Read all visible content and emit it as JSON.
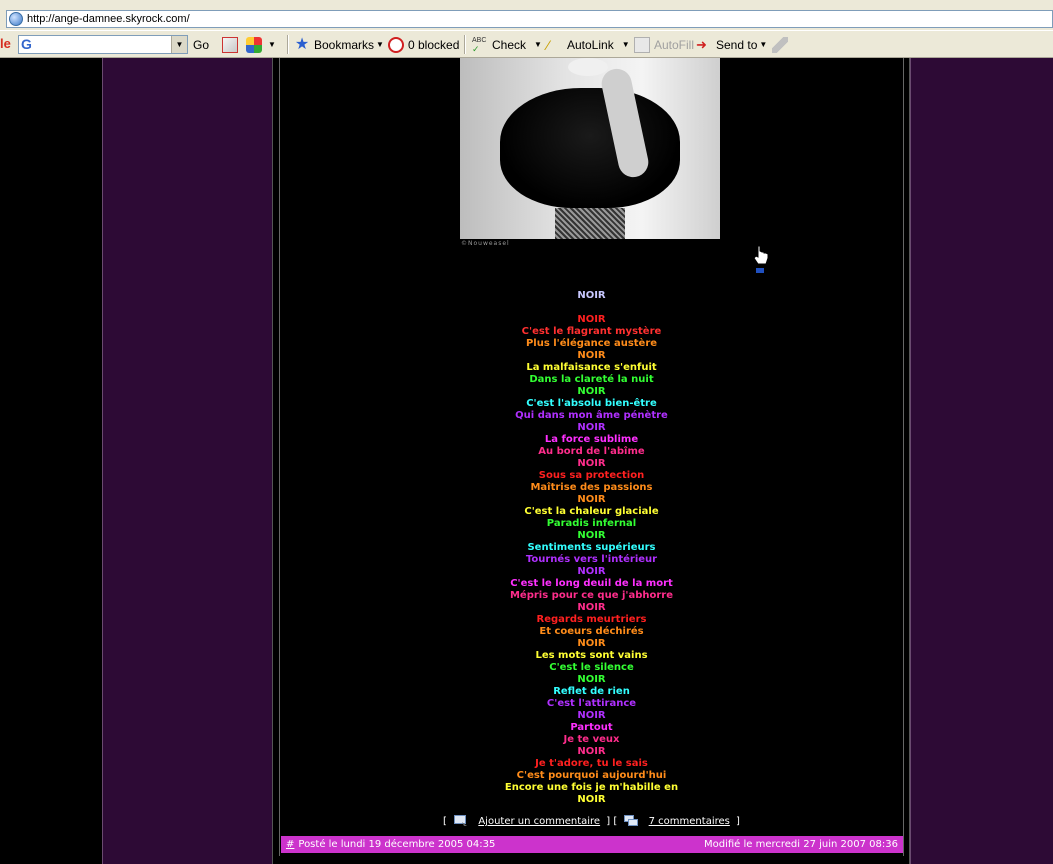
{
  "browser": {
    "address": "http://ange-damnee.skyrock.com/",
    "toolbar": {
      "go_label": "Go",
      "bookmarks_label": "Bookmarks",
      "blocked_label": "0 blocked",
      "check_label": "Check",
      "autolink_label": "AutoLink",
      "autofill_label": "AutoFill",
      "sendto_label": "Send to"
    }
  },
  "post": {
    "photo_caption": "©Nouweasel",
    "poem_title": "NOIR",
    "poem": [
      {
        "text": "NOIR",
        "color": "#ff2020"
      },
      {
        "text": "C'est le flagrant mystère",
        "color": "#ff3030"
      },
      {
        "text": "Plus l'élégance austère",
        "color": "#ff8c1a"
      },
      {
        "text": "NOIR",
        "color": "#ff8c1a"
      },
      {
        "text": "La malfaisance s'enfuit",
        "color": "#ffff33"
      },
      {
        "text": "Dans la clareté la nuit",
        "color": "#33ff33"
      },
      {
        "text": "NOIR",
        "color": "#33ff33"
      },
      {
        "text": "C'est l'absolu bien-être",
        "color": "#33ffff"
      },
      {
        "text": "Qui dans mon âme pénètre",
        "color": "#b030ff"
      },
      {
        "text": "NOIR",
        "color": "#b030ff"
      },
      {
        "text": "La force sublime",
        "color": "#ff30ff"
      },
      {
        "text": "Au bord de l'abîme",
        "color": "#ff2d8c"
      },
      {
        "text": "NOIR",
        "color": "#ff2d8c"
      },
      {
        "text": "Sous sa protection",
        "color": "#ff2020"
      },
      {
        "text": "Maîtrise des passions",
        "color": "#ff8c1a"
      },
      {
        "text": "NOIR",
        "color": "#ff8c1a"
      },
      {
        "text": "C'est la chaleur glaciale",
        "color": "#ffff33"
      },
      {
        "text": "Paradis infernal",
        "color": "#33ff33"
      },
      {
        "text": "NOIR",
        "color": "#33ff33"
      },
      {
        "text": "Sentiments supérieurs",
        "color": "#33ffff"
      },
      {
        "text": "Tournés vers l'intérieur",
        "color": "#b030ff"
      },
      {
        "text": "NOIR",
        "color": "#b030ff"
      },
      {
        "text": "C'est le long deuil de la mort",
        "color": "#ff30ff"
      },
      {
        "text": "Mépris pour ce que j'abhorre",
        "color": "#ff2d8c"
      },
      {
        "text": "NOIR",
        "color": "#ff2d8c"
      },
      {
        "text": "Regards meurtriers",
        "color": "#ff2020"
      },
      {
        "text": "Et coeurs déchirés",
        "color": "#ff8c1a"
      },
      {
        "text": "NOIR",
        "color": "#ff8c1a"
      },
      {
        "text": "Les mots sont vains",
        "color": "#ffff33"
      },
      {
        "text": "C'est le silence",
        "color": "#33ff33"
      },
      {
        "text": "NOIR",
        "color": "#33ff33"
      },
      {
        "text": "Reflet de rien",
        "color": "#33ffff"
      },
      {
        "text": "C'est l'attirance",
        "color": "#b030ff"
      },
      {
        "text": "NOIR",
        "color": "#b030ff"
      },
      {
        "text": "Partout",
        "color": "#ff30ff"
      },
      {
        "text": "Je te veux",
        "color": "#ff2d8c"
      },
      {
        "text": "NOIR",
        "color": "#ff2d8c"
      },
      {
        "text": "Je t'adore, tu le sais",
        "color": "#ff2020"
      },
      {
        "text": "C'est pourquoi aujourd'hui",
        "color": "#ff8c1a"
      },
      {
        "text": "Encore une fois je m'habille en",
        "color": "#ffff33"
      },
      {
        "text": "NOIR",
        "color": "#ffff33"
      }
    ],
    "actions": {
      "open": "[",
      "mid": "] [",
      "close": "]",
      "add_comment": "Ajouter un commentaire",
      "comments": "7 commentaires"
    },
    "footer": {
      "hash": "#",
      "posted": "Posté le lundi 19 décembre 2005 04:35",
      "modified": "Modifié le mercredi 27 juin 2007 08:36"
    }
  },
  "colors": {
    "sidebar_purple": "#2d0a35",
    "footer_magenta": "#cc33cc"
  }
}
